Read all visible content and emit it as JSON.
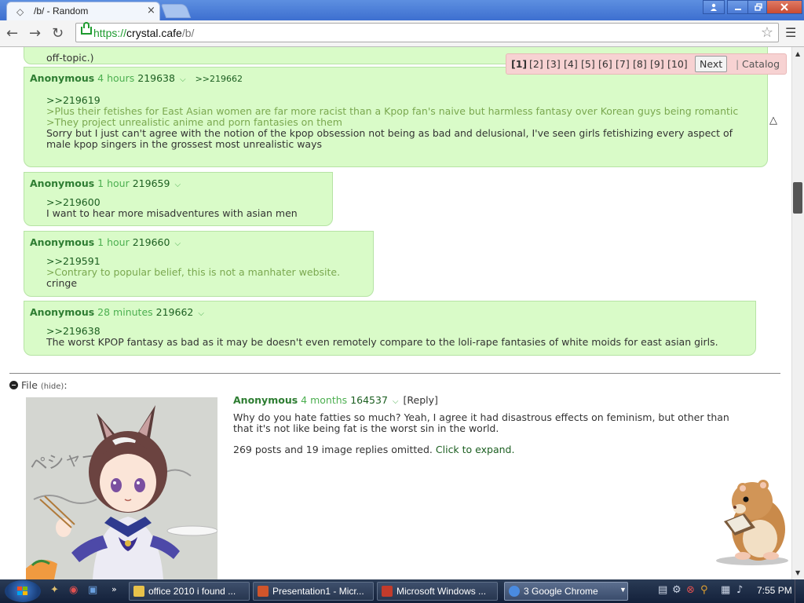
{
  "browser": {
    "tab_title": "/b/ - Random",
    "tab_close": "×",
    "url_scheme": "https://",
    "url_host": "crystal.cafe",
    "url_path": "/b/"
  },
  "pager": {
    "pages": [
      "[1]",
      "[2]",
      "[3]",
      "[4]",
      "[5]",
      "[6]",
      "[7]",
      "[8]",
      "[9]",
      "[10]"
    ],
    "next_label": "Next",
    "separator": "|",
    "catalog_label": "Catalog"
  },
  "thread": {
    "top_fragment": "off-topic.)",
    "replies": [
      {
        "name": "Anonymous",
        "time": "4 hours",
        "no": "219638",
        "backlink": ">>219662",
        "lines": [
          {
            "kind": "quote",
            "text": ">>219619"
          },
          {
            "kind": "green",
            "text": ">Plus their fetishes for East Asian women are far more racist than a Kpop fan's naive but harmless fantasy over Korean guys being romantic"
          },
          {
            "kind": "green",
            "text": ">They project unrealistic anime and porn fantasies on them"
          },
          {
            "kind": "plain",
            "text": "Sorry but I just can't agree with the notion of the kpop obsession not being as bad and delusional, I've seen girls fetishizing every aspect of male kpop singers in the grossest most unrealistic ways"
          }
        ]
      },
      {
        "name": "Anonymous",
        "time": "1 hour",
        "no": "219659",
        "backlink": "",
        "lines": [
          {
            "kind": "quote",
            "text": ">>219600"
          },
          {
            "kind": "plain",
            "text": "I want to hear more misadventures with asian men"
          }
        ]
      },
      {
        "name": "Anonymous",
        "time": "1 hour",
        "no": "219660",
        "backlink": "",
        "lines": [
          {
            "kind": "quote",
            "text": ">>219591"
          },
          {
            "kind": "green",
            "text": ">Contrary to popular belief, this is not a manhater website."
          },
          {
            "kind": "plain",
            "text": "cringe"
          }
        ]
      },
      {
        "name": "Anonymous",
        "time": "28 minutes",
        "no": "219662",
        "backlink": "",
        "lines": [
          {
            "kind": "quote",
            "text": ">>219638"
          },
          {
            "kind": "plain",
            "text": "The worst KPOP fantasy as bad as it may be doesn't even remotely compare to the loli-rape fantasies of white moids for east asian girls."
          }
        ]
      }
    ]
  },
  "next_thread": {
    "file_label": "File",
    "hide_label": "(hide)",
    "file_suffix": ":",
    "image_text": "ペシャーーク",
    "name": "Anonymous",
    "time": "4 months",
    "no": "164537",
    "reply_label": "[Reply]",
    "text": "Why do you hate fatties so much? Yeah, I agree it had disastrous effects on feminism, but other than that it's not like being fat is the worst sin in the world.",
    "omitted_text": "269 posts and 19 image replies omitted.",
    "expand_label": "Click to expand."
  },
  "taskbar": {
    "tasks": [
      {
        "label": "office 2010 i found ...",
        "color": "#e8c24a"
      },
      {
        "label": "Presentation1 - Micr...",
        "color": "#d0552b"
      },
      {
        "label": "Microsoft Windows ...",
        "color": "#c23b2b"
      },
      {
        "label": "3  Google Chrome",
        "color": "#4a8be0"
      }
    ],
    "clock": "7:55 PM"
  },
  "colors": {
    "reply_bg": "#d9fbc8",
    "name_green": "#2e7d32",
    "greentext": "#7aa84f",
    "pager_bg": "#f7d2d2"
  }
}
